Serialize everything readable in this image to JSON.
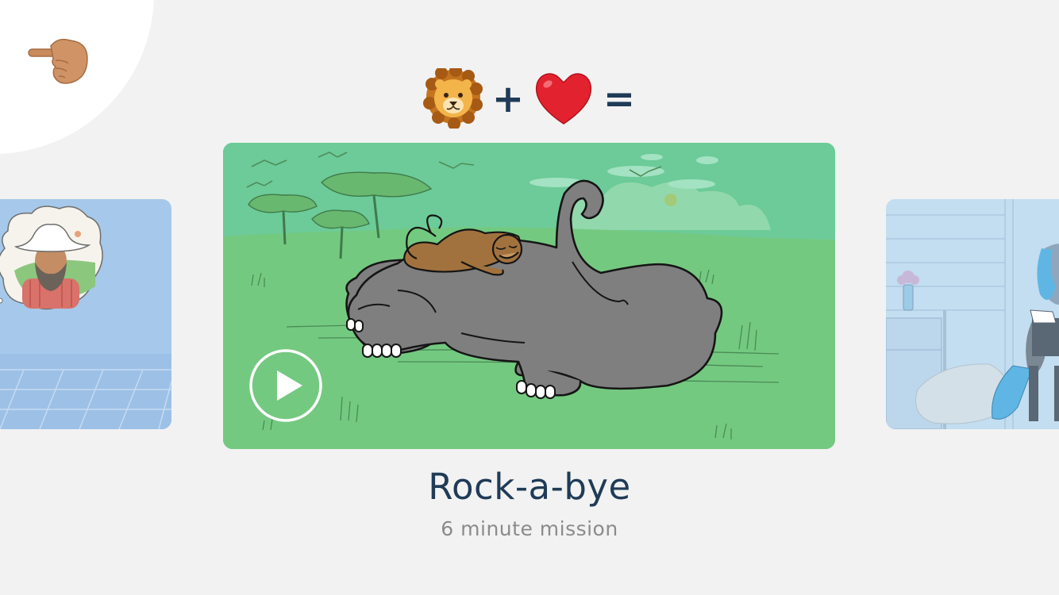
{
  "hint": {
    "icon": "pointing-hand-icon"
  },
  "equation": {
    "items": [
      "lion-face-icon",
      "+",
      "red-heart-icon",
      "="
    ],
    "plus_sign": "+",
    "equals_sign": "="
  },
  "carousel": {
    "previous_card": {
      "illustration": "cowboy-thought-bubble"
    },
    "current_card": {
      "illustration": "monkey-sleeping-on-elephant",
      "play_icon": "play-icon"
    },
    "next_card": {
      "illustration": "blue-haired-figure-in-room"
    }
  },
  "mission": {
    "title": "Rock-a-bye",
    "duration": "6 minute mission"
  },
  "colors": {
    "background": "#f2f2f2",
    "title": "#1f3b57",
    "subtitle": "#8b8b8b",
    "main_card_grass": "#74c980",
    "main_card_sky": "#6ccb98",
    "elephant": "#7f7f7f",
    "monkey": "#a2723e",
    "heart": "#e3222f",
    "prev_card": "#a6c8ea",
    "next_card": "#c3ddf1"
  }
}
